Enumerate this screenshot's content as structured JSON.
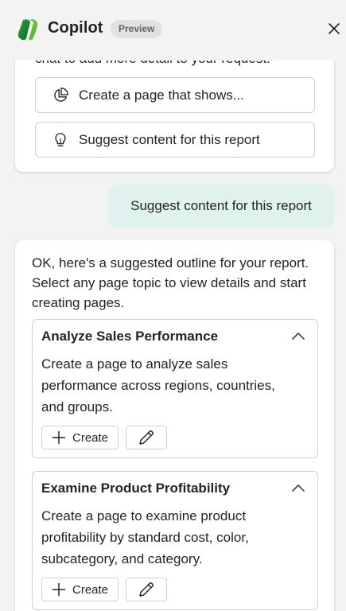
{
  "header": {
    "title": "Copilot",
    "badge": "Preview"
  },
  "prior_card": {
    "clipped_text": "chat to add more detail to your request.",
    "buttons": [
      {
        "label": "Create a page that shows...",
        "icon": "pie-chart-icon"
      },
      {
        "label": "Suggest content for this report",
        "icon": "lightbulb-icon"
      }
    ]
  },
  "user_message": "Suggest content for this report",
  "response": {
    "intro": "OK, here's a suggested outline for your report. Select any page topic to view details and start creating pages.",
    "topics": [
      {
        "title": "Analyze Sales Performance",
        "description": "Create a page to analyze sales performance across regions, countries, and groups.",
        "create_label": "Create"
      },
      {
        "title": "Examine Product Profitability",
        "description": "Create a page to examine product profitability by standard cost, color, subcategory, and category.",
        "create_label": "Create"
      }
    ]
  }
}
